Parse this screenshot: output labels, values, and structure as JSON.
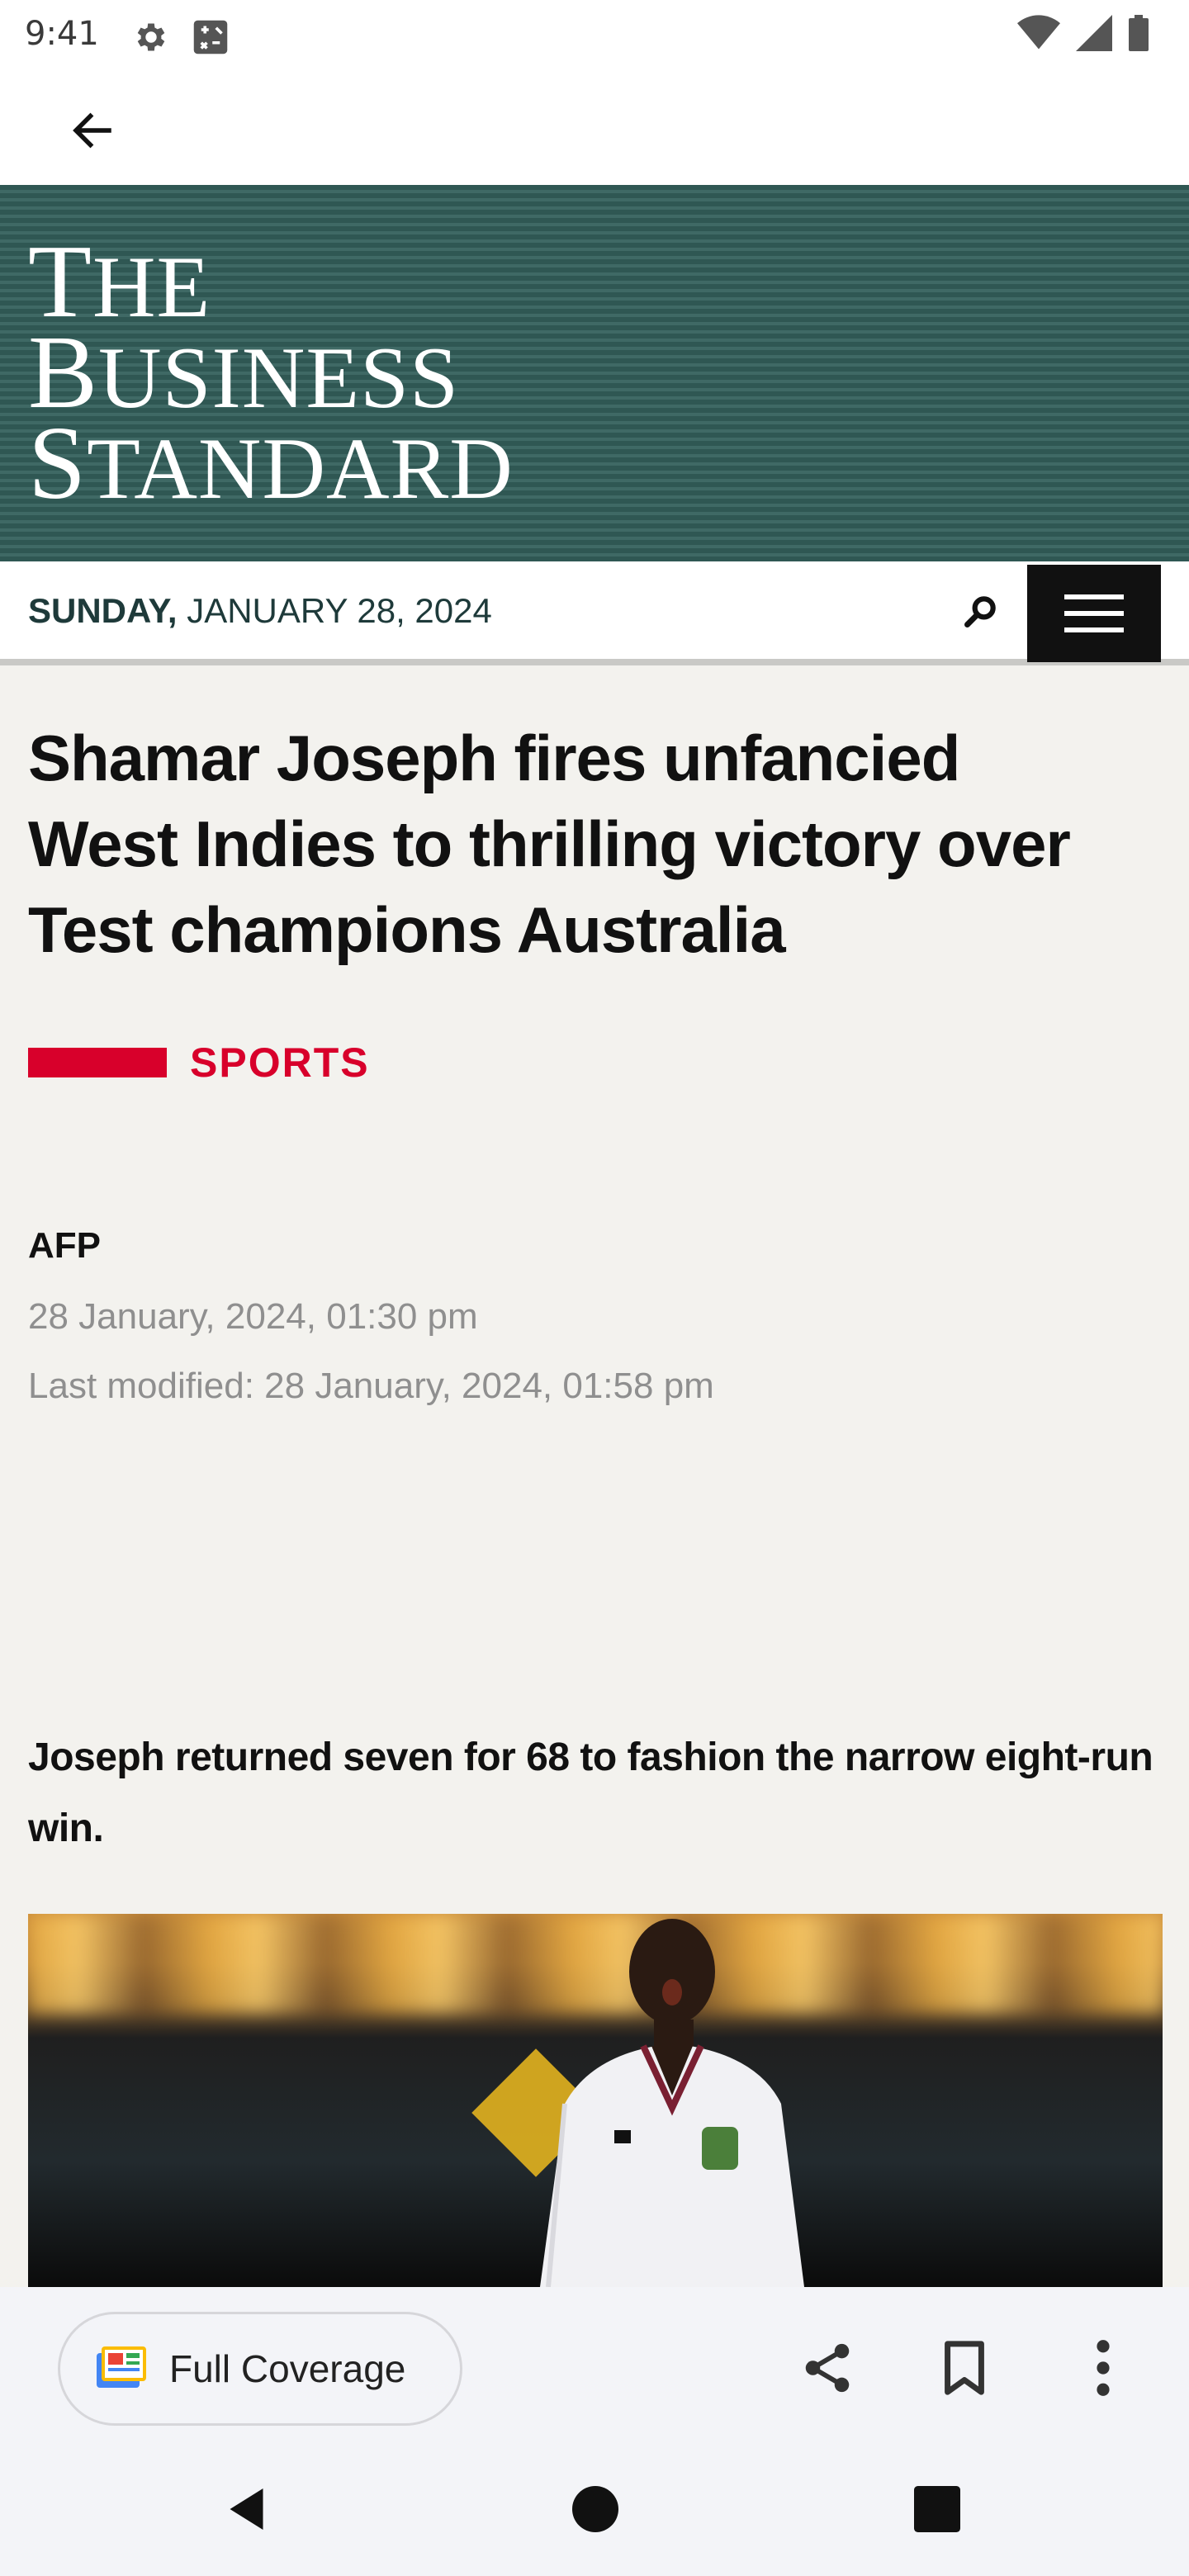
{
  "status_bar": {
    "time": "9:41",
    "left_icons": [
      "gear-icon",
      "scratch-pad-icon"
    ],
    "right_icons": [
      "wifi-icon",
      "signal-icon",
      "battery-icon"
    ]
  },
  "app_bar": {
    "back_icon": "arrow-back-icon"
  },
  "masthead": {
    "line1_first": "T",
    "line1_rest": "HE",
    "line2_first": "B",
    "line2_rest": "USINESS",
    "line3_first": "S",
    "line3_rest": "TANDARD",
    "background_color": "#2e5551"
  },
  "date_bar": {
    "day": "SUNDAY,",
    "date": "JANUARY 28, 2024",
    "search_icon": "search-icon",
    "menu_icon": "hamburger-menu-icon"
  },
  "article": {
    "headline": "Shamar Joseph fires unfancied West Indies to thrilling victory over Test champions Australia",
    "section": "SPORTS",
    "section_color": "#d8002b",
    "author": "AFP",
    "published": "28 January, 2024, 01:30 pm",
    "modified": "Last modified: 28 January, 2024, 01:58 pm",
    "summary": "Joseph returned seven for 68 to fashion the narrow eight-run win."
  },
  "toolbar": {
    "full_coverage_label": "Full Coverage",
    "full_coverage_icon": "newspaper-icon",
    "share_icon": "share-icon",
    "bookmark_icon": "bookmark-icon",
    "more_icon": "more-vert-icon"
  },
  "nav_bar": {
    "back": "nav-back-icon",
    "home": "nav-home-icon",
    "recents": "nav-recents-icon"
  }
}
